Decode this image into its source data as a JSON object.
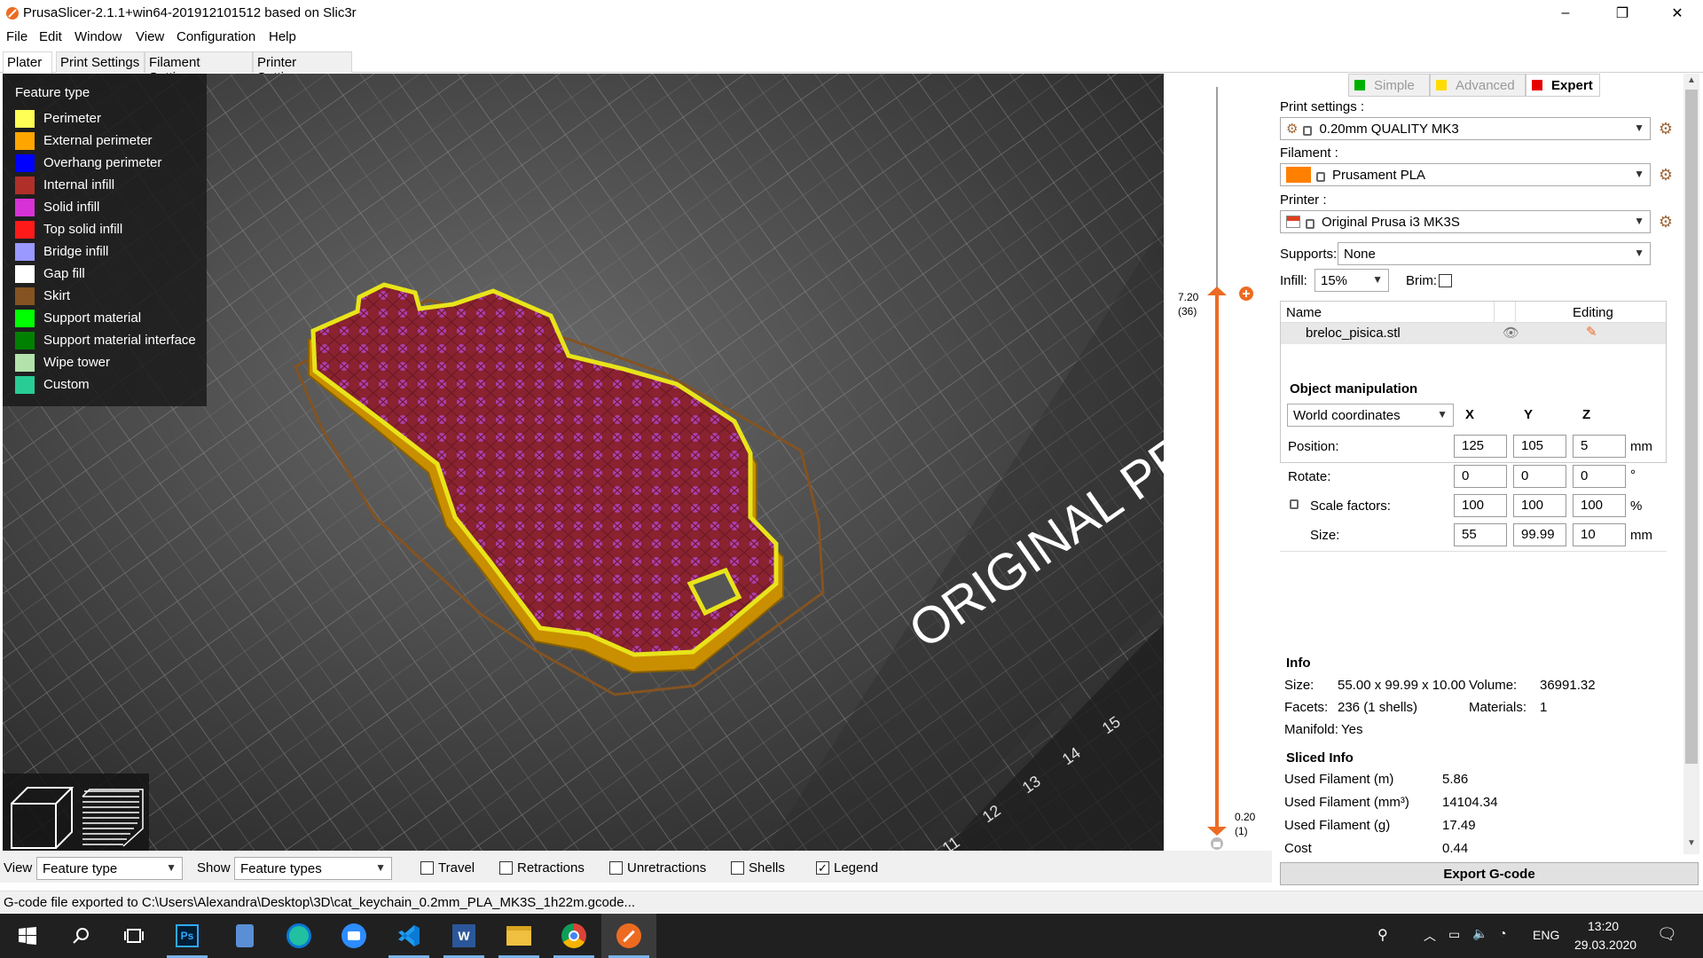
{
  "window": {
    "title": "PrusaSlicer-2.1.1+win64-201912101512 based on Slic3r",
    "minimize": "–",
    "maximize": "❐",
    "close": "✕"
  },
  "menu": [
    "File",
    "Edit",
    "Window",
    "View",
    "Configuration",
    "Help"
  ],
  "tabs": [
    "Plater",
    "Print Settings",
    "Filament Settings",
    "Printer Settings"
  ],
  "legend": {
    "title": "Feature type",
    "items": [
      {
        "label": "Perimeter",
        "color": "#ffff55"
      },
      {
        "label": "External perimeter",
        "color": "#ffa500"
      },
      {
        "label": "Overhang perimeter",
        "color": "#0000ff"
      },
      {
        "label": "Internal infill",
        "color": "#b03029"
      },
      {
        "label": "Solid infill",
        "color": "#d732d7"
      },
      {
        "label": "Top solid infill",
        "color": "#ff1a1a"
      },
      {
        "label": "Bridge infill",
        "color": "#9999ff"
      },
      {
        "label": "Gap fill",
        "color": "#ffffff"
      },
      {
        "label": "Skirt",
        "color": "#845321"
      },
      {
        "label": "Support material",
        "color": "#00ff00"
      },
      {
        "label": "Support material interface",
        "color": "#008000"
      },
      {
        "label": "Wipe tower",
        "color": "#b3e3ab"
      },
      {
        "label": "Custom",
        "color": "#28cc94"
      }
    ]
  },
  "bed": {
    "label": "ORIGINAL PRU",
    "ticks": [
      "11",
      "12",
      "13",
      "14",
      "15"
    ]
  },
  "layer_slider": {
    "top_value": "7.20",
    "top_layer": "(36)",
    "bottom_value": "0.20",
    "bottom_layer": "(1)",
    "accent": "#ed6b21"
  },
  "modes": {
    "simple": "Simple",
    "advanced": "Advanced",
    "expert": "Expert",
    "simple_color": "#00b000",
    "advanced_color": "#ffdc00",
    "expert_color": "#e70000"
  },
  "print_settings": {
    "label": "Print settings :",
    "value": "0.20mm QUALITY MK3"
  },
  "filament": {
    "label": "Filament :",
    "value": "Prusament PLA",
    "color": "#ff8000"
  },
  "printer": {
    "label": "Printer :",
    "value": "Original Prusa i3 MK3S"
  },
  "supports": {
    "label": "Supports:",
    "value": "None"
  },
  "infill": {
    "label": "Infill:",
    "value": "15%"
  },
  "brim": {
    "label": "Brim:"
  },
  "object_list": {
    "col_name": "Name",
    "col_editing": "Editing",
    "items": [
      "breloc_pisica.stl"
    ]
  },
  "object_manipulation": {
    "title": "Object manipulation",
    "coords": "World coordinates",
    "axes": [
      "X",
      "Y",
      "Z"
    ],
    "rows": [
      {
        "label": "Position:",
        "values": [
          "125",
          "105",
          "5"
        ],
        "unit": "mm"
      },
      {
        "label": "Rotate:",
        "values": [
          "0",
          "0",
          "0"
        ],
        "unit": "°"
      },
      {
        "label": "Scale factors:",
        "values": [
          "100",
          "100",
          "100"
        ],
        "unit": "%"
      },
      {
        "label": "Size:",
        "values": [
          "55",
          "99.99",
          "10"
        ],
        "unit": "mm"
      }
    ]
  },
  "info": {
    "title": "Info",
    "size_label": "Size:",
    "size": "55.00 x 99.99 x 10.00",
    "volume_label": "Volume:",
    "volume": "36991.32",
    "facets_label": "Facets:",
    "facets": "236 (1 shells)",
    "materials_label": "Materials:",
    "materials": "1",
    "manifold_label": "Manifold:",
    "manifold": "Yes"
  },
  "sliced_info": {
    "title": "Sliced Info",
    "rows": [
      {
        "label": "Used Filament (m)",
        "value": "5.86"
      },
      {
        "label": "Used Filament (mm³)",
        "value": "14104.34"
      },
      {
        "label": "Used Filament (g)",
        "value": "17.49"
      },
      {
        "label": "Cost",
        "value": "0.44"
      }
    ]
  },
  "export_button": "Export G-code",
  "bottom": {
    "view_label": "View",
    "view_value": "Feature type",
    "show_label": "Show",
    "show_value": "Feature types",
    "checks": [
      {
        "label": "Travel",
        "checked": false
      },
      {
        "label": "Retractions",
        "checked": false
      },
      {
        "label": "Unretractions",
        "checked": false
      },
      {
        "label": "Shells",
        "checked": false
      },
      {
        "label": "Legend",
        "checked": true
      }
    ]
  },
  "status": "G-code file exported to C:\\Users\\Alexandra\\Desktop\\3D\\cat_keychain_0.2mm_PLA_MK3S_1h22m.gcode...",
  "taskbar": {
    "language": "ENG",
    "time": "13:20",
    "date": "29.03.2020",
    "apps": [
      "start-icon",
      "search-icon",
      "task-view-icon",
      "photoshop-icon",
      "file-icon",
      "chat-icon",
      "zoom-icon",
      "vscode-icon",
      "word-icon",
      "explorer-icon",
      "chrome-icon",
      "prusaslicer-icon"
    ]
  }
}
